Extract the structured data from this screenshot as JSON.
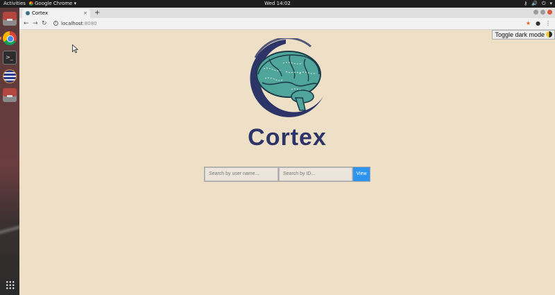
{
  "topbar": {
    "activities": "Activities",
    "app_menu": "Google Chrome ▾",
    "clock": "Wed 14:02",
    "tray": [
      "⚷",
      "🔊",
      "⏻",
      "▾"
    ]
  },
  "browser": {
    "tab_title": "Cortex",
    "tab_close": "×",
    "new_tab": "+",
    "url_host": "localhost",
    "url_port": ":8080",
    "nav": {
      "back": "←",
      "forward": "→",
      "reload": "↻"
    },
    "star": "★",
    "account": "●",
    "menu": "⋮"
  },
  "page": {
    "dark_mode_label": "Toggle dark mode",
    "brand": "Cortex",
    "search": {
      "name_placeholder": "Search by user name...",
      "id_placeholder": "Search by ID...",
      "button_label": "View"
    }
  },
  "colors": {
    "page_background": "#ede0c6",
    "brand": "#2c3468",
    "button": "#2f93f0",
    "brain": "#4fa59a"
  },
  "icons": [
    "chrome-icon",
    "files-icon",
    "terminal-icon",
    "globe-icon",
    "app-grid-icon",
    "info-icon",
    "star-icon",
    "account-icon",
    "menu-icon",
    "halfmoon-icon",
    "brain-logo-icon"
  ]
}
